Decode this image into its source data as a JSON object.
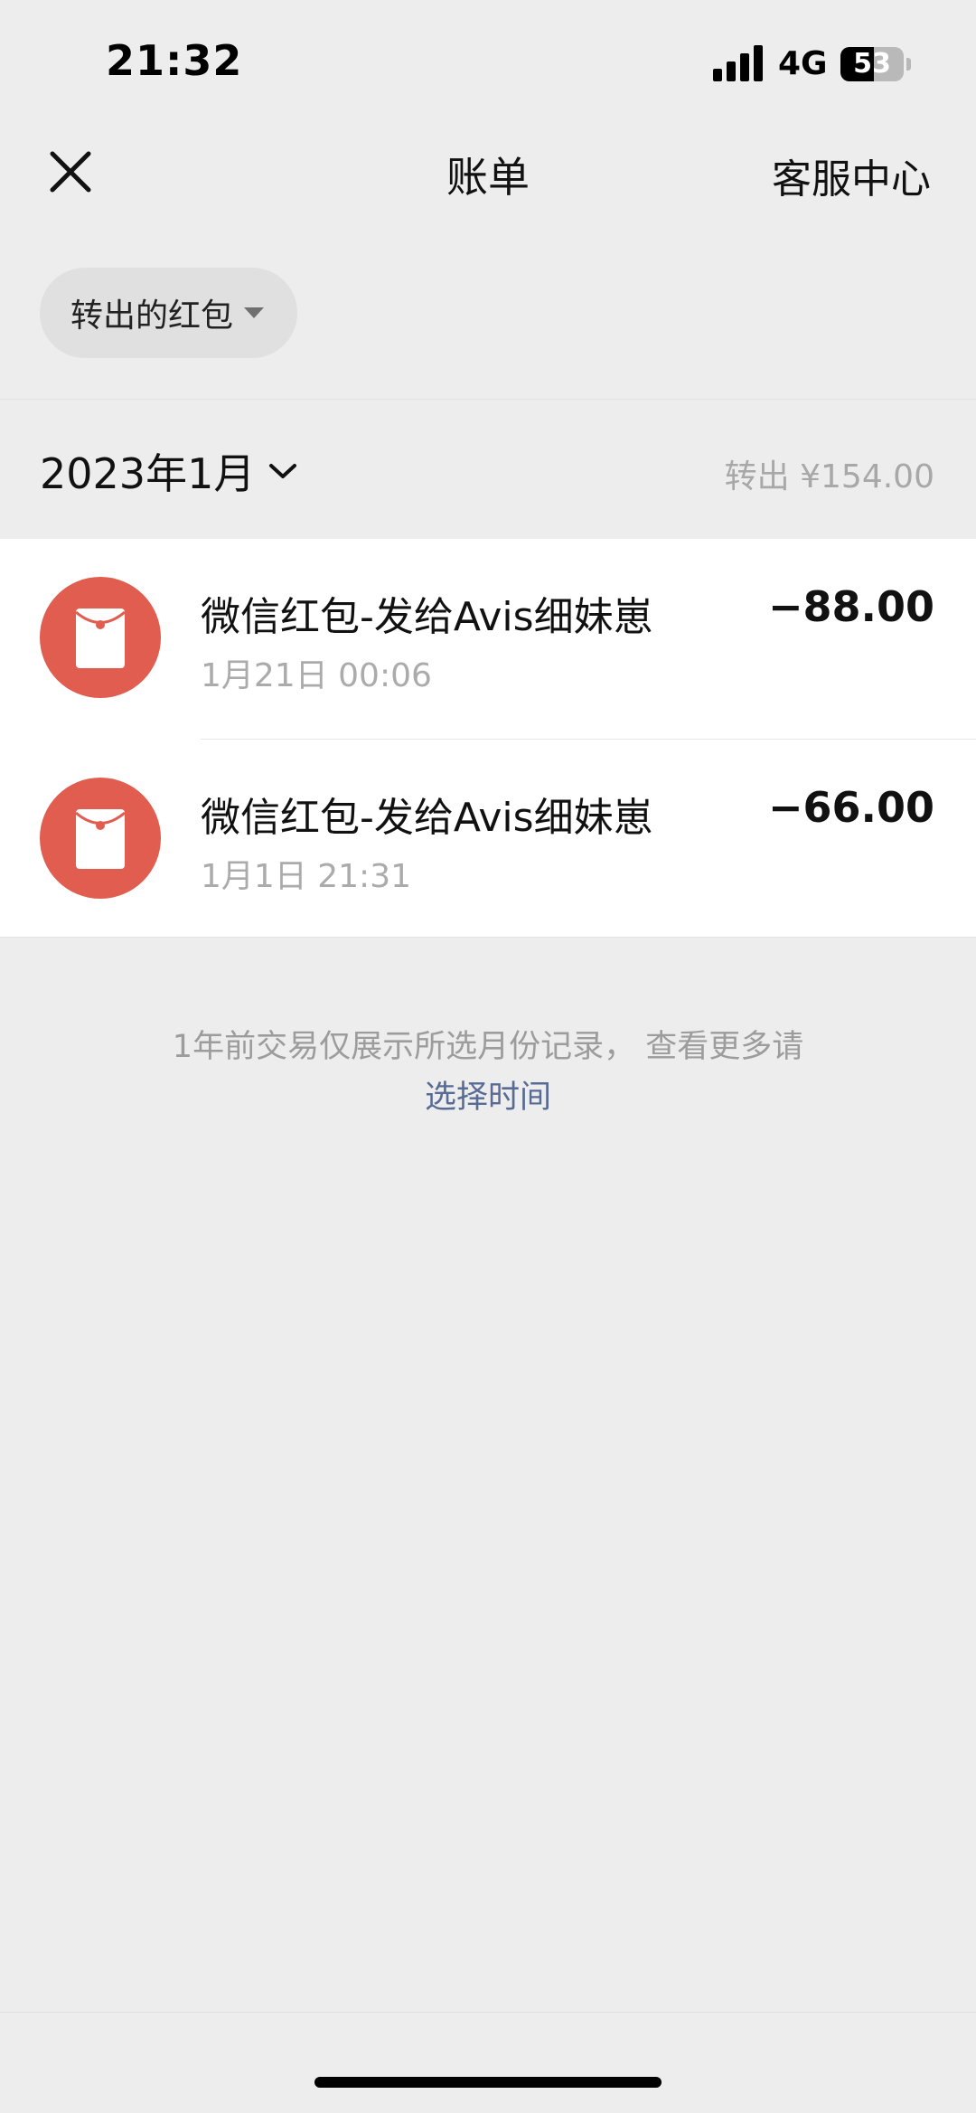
{
  "status_bar": {
    "time": "21:32",
    "network": "4G",
    "battery": "53",
    "battery_level_percent": 53,
    "icons": [
      "signal-icon",
      "battery-icon"
    ]
  },
  "nav": {
    "title": "账单",
    "service_label": "客服中心",
    "close_icon": "close-icon"
  },
  "filter": {
    "label": "转出的红包",
    "caret_icon": "caret-down-icon"
  },
  "month": {
    "label": "2023年1月",
    "chevron_icon": "chevron-down-icon",
    "summary": "转出 ¥154.00"
  },
  "transactions": [
    {
      "title": "微信红包-发给Avis细妹崽",
      "time": "1月21日 00:06",
      "amount": "−88.00",
      "icon": "red-packet-icon"
    },
    {
      "title": "微信红包-发给Avis细妹崽",
      "time": "1月1日 21:31",
      "amount": "−66.00",
      "icon": "red-packet-icon"
    }
  ],
  "notice": {
    "text": "1年前交易仅展示所选月份记录， 查看更多请",
    "link": "选择时间"
  },
  "colors": {
    "background": "#EDEDED",
    "red_packet": "#E15D4F",
    "link": "#576B95",
    "secondary_text": "#A8A8A8"
  }
}
